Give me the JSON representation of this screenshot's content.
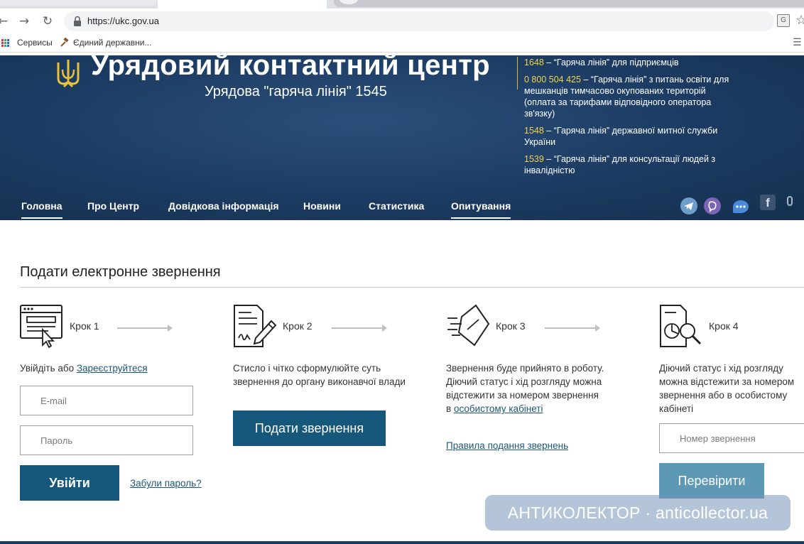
{
  "browser": {
    "url": "https://ukc.gov.ua",
    "bookmarks": [
      "Сервисы",
      "Єдиний державни..."
    ]
  },
  "header": {
    "title": "Урядовий контактний центр",
    "subtitle": "Урядова \"гаряча лінія\" 1545",
    "hotlines": [
      {
        "number": "1648",
        "text": " – “Гаряча лінія” для підприємців"
      },
      {
        "number": "0 800 504 425",
        "text": " – “Гаряча лінія” з питань освіти для мешканців тимчасово окупованих територій (оплата за тарифами відповідного оператора зв'язку)"
      },
      {
        "number": "1548",
        "text": " – “Гаряча лінія” державної митної служби України"
      },
      {
        "number": "1539",
        "text": " – “Гаряча лінія” для консультації людей з інвалідністю"
      }
    ]
  },
  "nav": {
    "items": [
      "Головна",
      "Про Центр",
      "Довідкова інформація",
      "Новини",
      "Статистика",
      "Опитування"
    ],
    "active": [
      "Головна",
      "Опитування"
    ]
  },
  "main": {
    "section_title": "Подати електронне звернення",
    "steps": [
      {
        "label": "Крок 1",
        "text_before": "Увійдіть або ",
        "link": "Зареєструйтеся"
      },
      {
        "label": "Крок 2",
        "text": "Стисло і чітко сформулюйте суть звернення до органу виконавчої влади"
      },
      {
        "label": "Крок 3",
        "text": "Звернення буде прийнято в роботу. Діючий статус і хід розгляду можна відстежити за номером звернення в ",
        "link": "особистому кабінеті",
        "link2": "Правила подання звернень"
      },
      {
        "label": "Крок 4",
        "text": "Діючий статус і хід розгляду можна відстежити за номером звернення або в особистому кабінеті"
      }
    ],
    "email_placeholder": "E-mail",
    "password_placeholder": "Пароль",
    "login_button": "Увійти",
    "forgot_link": "Забули пароль?",
    "submit_button": "Подати звернення",
    "number_placeholder": "Номер звернення",
    "check_button": "Перевірити"
  },
  "watermark": "АНТИКОЛЕКТОР · anticollector.ua"
}
